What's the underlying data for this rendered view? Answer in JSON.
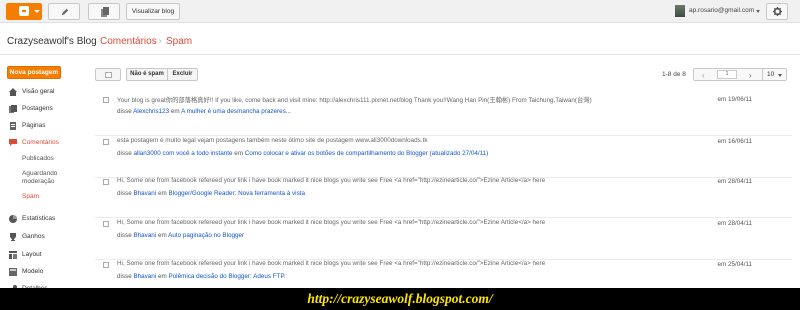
{
  "topbar": {
    "view_blog_label": "Visualizar blog",
    "account_email": "ap.rosario@gmail.com"
  },
  "header": {
    "blog_title": "Crazyseawolf's Blog",
    "breadcrumbs": [
      "Comentários",
      "Spam"
    ]
  },
  "sidebar": {
    "new_post_label": "Nova postagem",
    "items": [
      {
        "label": "Visão geral",
        "icon": "home-icon"
      },
      {
        "label": "Postagens",
        "icon": "posts-icon"
      },
      {
        "label": "Páginas",
        "icon": "pages-icon"
      },
      {
        "label": "Comentários",
        "icon": "comments-icon",
        "active": true
      },
      {
        "label": "Estatísticas",
        "icon": "stats-icon"
      },
      {
        "label": "Ganhos",
        "icon": "earnings-icon"
      },
      {
        "label": "Layout",
        "icon": "layout-icon"
      },
      {
        "label": "Modelo",
        "icon": "template-icon"
      },
      {
        "label": "Detalhes",
        "icon": "settings-icon"
      }
    ],
    "comment_subitems": [
      "Publicados",
      "Aguardando moderação",
      "Spam"
    ]
  },
  "toolbar": {
    "not_spam_label": "Não é spam",
    "delete_label": "Excluir",
    "range_label": "1-8 de 8",
    "page_value": "1",
    "per_page_value": "10"
  },
  "comments": [
    {
      "text": "Your blog is great你的部落格真好!! If you like, come back and visit mine: http://alexchris111.pixnet.net/blog Thank you!!Wang Han Pin(王翰彬) From Taichung,Taiwan(台灣)",
      "said": "disse",
      "author": "Alexchris123",
      "in": "em",
      "post": "A mulher é uma desmancha prazeres...",
      "date": "em 19/06/11"
    },
    {
      "text": "esta postagem é muito legal vejam postagens também neste ótimo site de postagem www.all3000downloads.tk",
      "said": "disse",
      "author": "allan3000 com você a todo instante",
      "in": "em",
      "post": "Como colocar e ativar os botões de compartilhamento do Blogger (atualizado 27/04/11)",
      "date": "em 16/06/11"
    },
    {
      "text": "Hi, Some one from facebook refereed your link i have book marked it nice blogs you write see Free <a href=\"http://ezinearticle.co/\">Ezine Article</a> here",
      "said": "disse",
      "author": "Bhavani",
      "in": "em",
      "post": "Blogger/Google Reader: Nova ferramenta à vista",
      "date": "em 28/04/11"
    },
    {
      "text": "Hi, Some one from facebook refereed your link i have book marked it nice blogs you write see Free <a href=\"http://ezinearticle.co/\">Ezine Article</a> here",
      "said": "disse",
      "author": "Bhavani",
      "in": "em",
      "post": "Auto paginação no Blogger",
      "date": "em 28/04/11"
    },
    {
      "text": "Hi, Some one from facebook refereed your link i have book marked it nice blogs you write see Free <a href=\"http://ezinearticle.co/\">Ezine Article</a> here",
      "said": "disse",
      "author": "Bhavani",
      "in": "em",
      "post": "Polêmica decisão do Blogger: Adeus FTP.",
      "date": "em 25/04/11"
    }
  ],
  "banner": {
    "url_text": "http://crazyseawolf.blogspot.com/"
  },
  "colors": {
    "brand_orange": "#f57d00",
    "accent_red": "#dd4b39",
    "link_blue": "#1155cc",
    "banner_text": "#ffe600"
  }
}
